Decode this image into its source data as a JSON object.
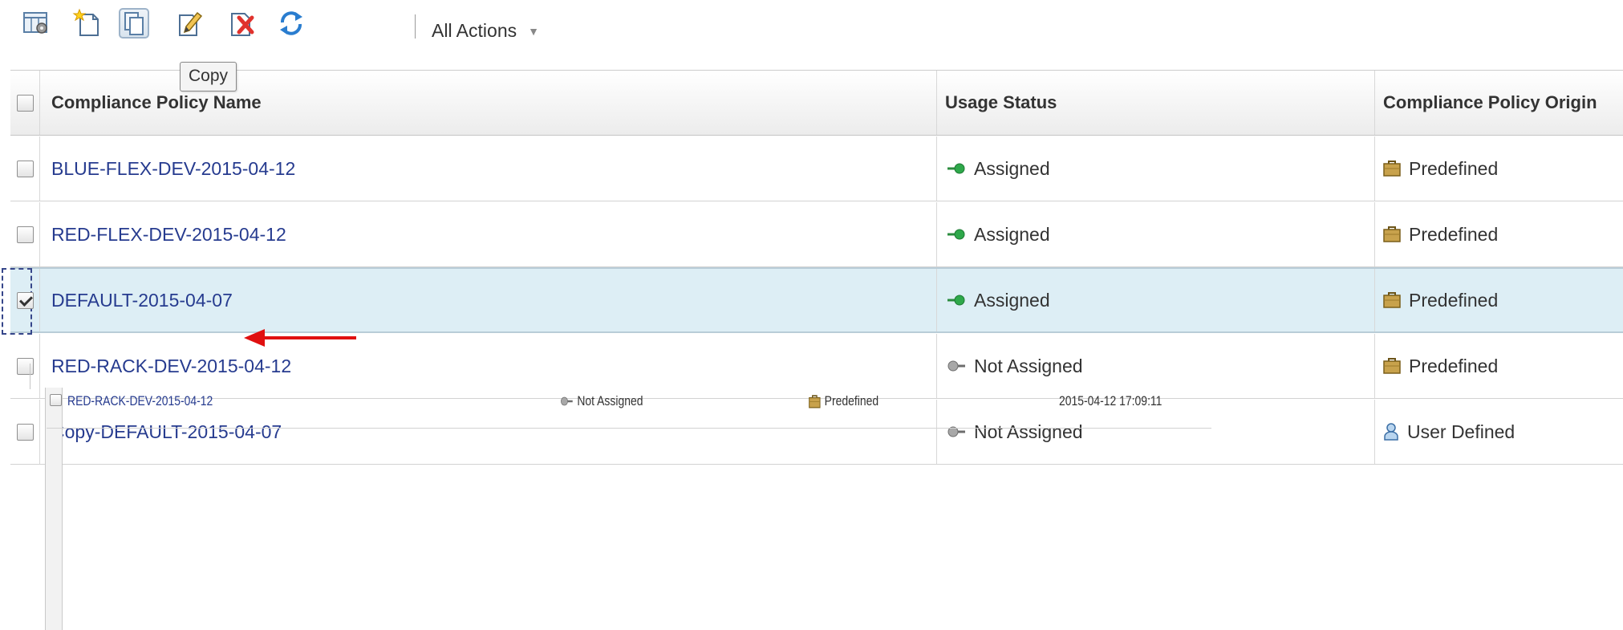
{
  "toolbar": {
    "all_actions_label": "All Actions",
    "tooltip": "Copy",
    "icons": [
      "configure-columns-icon",
      "new-policy-icon",
      "copy-icon",
      "edit-icon",
      "delete-icon",
      "refresh-icon"
    ]
  },
  "table": {
    "columns": {
      "name": "Compliance Policy Name",
      "usage": "Usage Status",
      "origin": "Compliance Policy Origin"
    },
    "rows": [
      {
        "name": "BLUE-FLEX-DEV-2015-04-12",
        "usage": "Assigned",
        "origin": "Predefined",
        "selected": false
      },
      {
        "name": "RED-FLEX-DEV-2015-04-12",
        "usage": "Assigned",
        "origin": "Predefined",
        "selected": false
      },
      {
        "name": "DEFAULT-2015-04-07",
        "usage": "Assigned",
        "origin": "Predefined",
        "selected": true
      },
      {
        "name": "RED-RACK-DEV-2015-04-12",
        "usage": "Not Assigned",
        "origin": "Predefined",
        "selected": false
      },
      {
        "name": "Copy-DEFAULT-2015-04-07",
        "usage": "Not Assigned",
        "origin": "User Defined",
        "selected": false
      }
    ]
  },
  "inset": {
    "row": {
      "name": "RED-RACK-DEV-2015-04-12",
      "usage": "Not Assigned",
      "origin": "Predefined",
      "timestamp": "2015-04-12 17:09:11"
    }
  },
  "colors": {
    "link": "#263b8f",
    "selected_row": "#ddeef5",
    "assigned_green": "#2ea84a",
    "annotation_arrow": "#e01010"
  }
}
